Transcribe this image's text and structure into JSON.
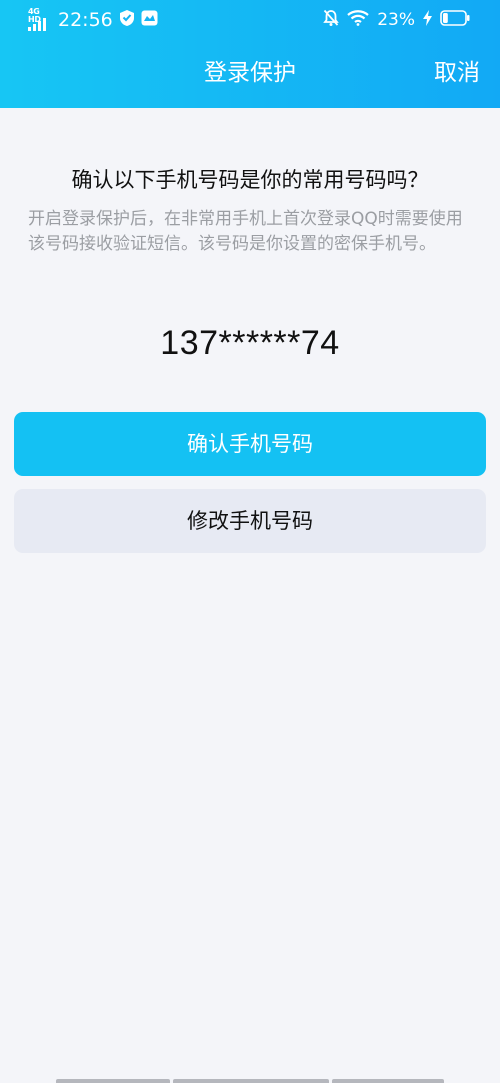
{
  "status_bar": {
    "network_label": "4G HD",
    "time": "22:56",
    "battery_percent": "23%",
    "left_icons": [
      "signal-icon",
      "shield-icon",
      "message-icon"
    ],
    "right_icons": [
      "mute-bell-icon",
      "wifi-icon",
      "charging-icon",
      "battery-icon"
    ]
  },
  "nav": {
    "title": "登录保护",
    "cancel_label": "取消"
  },
  "content": {
    "question": "确认以下手机号码是你的常用号码吗？",
    "description": "开启登录保护后，在非常用手机上首次登录QQ时需要使用该号码接收验证短信。该号码是你设置的密保手机号。",
    "phone_number": "137******74"
  },
  "buttons": {
    "confirm_label": "确认手机号码",
    "modify_label": "修改手机号码"
  },
  "colors": {
    "header_gradient_start": "#17c6f4",
    "header_gradient_end": "#12a9f5",
    "primary_button": "#14c1f3",
    "secondary_button": "#e7eaf3",
    "description_text": "#9b9ea3",
    "background": "#f4f5f9"
  },
  "battery_level": 0.23
}
